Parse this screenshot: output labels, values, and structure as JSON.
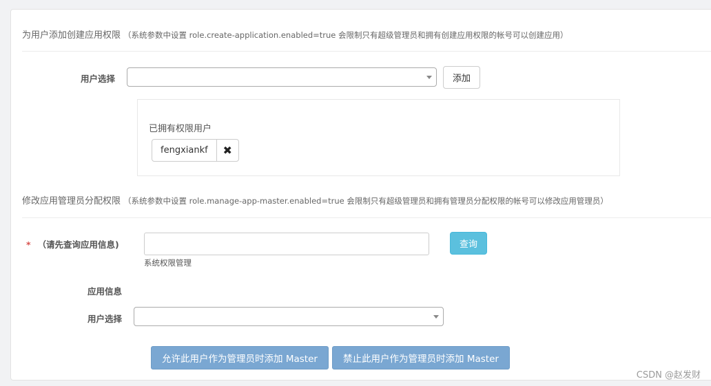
{
  "section1": {
    "title": "为用户添加创建应用权限",
    "note": "（系统参数中设置 role.create-application.enabled=true 会限制只有超级管理员和拥有创建应用权限的帐号可以创建应用）",
    "user_select_label": "用户选择",
    "user_select_value": "",
    "add_button": "添加",
    "owned_title": "已拥有权限用户",
    "owned_users": [
      "fengxiankf"
    ],
    "remove_icon": "✖"
  },
  "section2": {
    "title": "修改应用管理员分配权限",
    "note": "（系统参数中设置 role.manage-app-master.enabled=true 会限制只有超级管理员和拥有管理员分配权限的帐号可以修改应用管理员）",
    "required_mark": "*",
    "app_query_label": "（请先查询应用信息)",
    "app_query_value": "",
    "query_button": "查询",
    "help_text": "系统权限管理",
    "app_info_label": "应用信息",
    "user_select_label": "用户选择",
    "user_select_value": "",
    "allow_button": "允许此用户作为管理员时添加 Master",
    "deny_button": "禁止此用户作为管理员时添加 Master"
  },
  "watermark": "CSDN @赵发财",
  "colors": {
    "info": "#5bc0de",
    "primary_disabled": "#7aa7d2",
    "required": "#d9534f"
  }
}
